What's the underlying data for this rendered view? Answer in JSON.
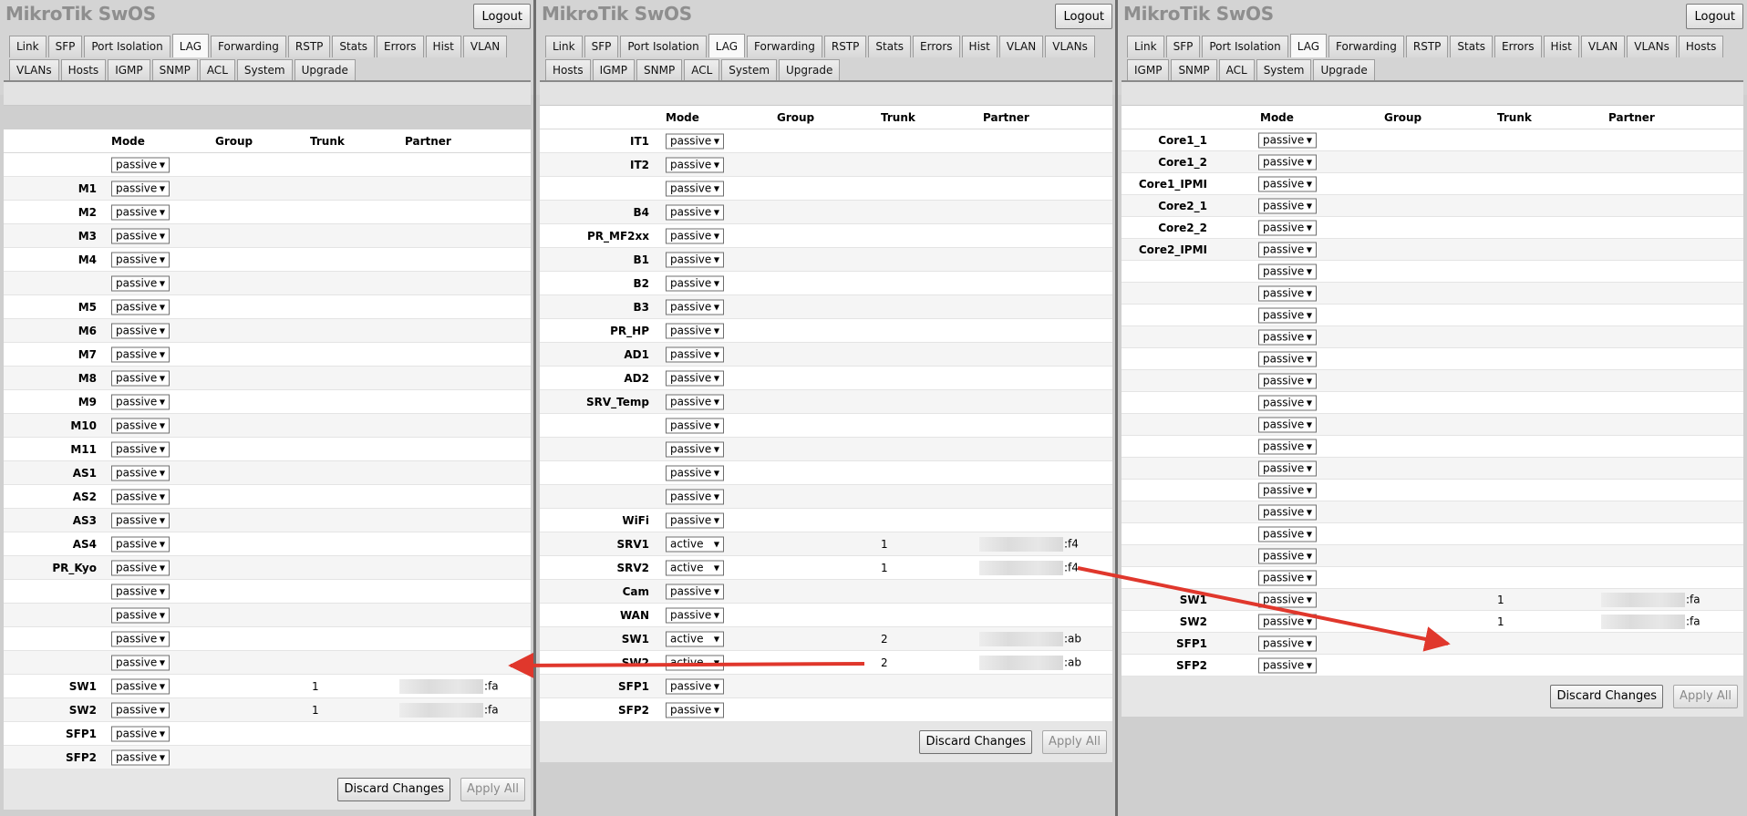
{
  "app": {
    "brand": "MikroTik SwOS",
    "logout_label": "Logout"
  },
  "colors": {
    "arrow": "#e0372c",
    "panel_bg": "#cfcfcf"
  },
  "headers": {
    "mode": "Mode",
    "group": "Group",
    "trunk": "Trunk",
    "partner": "Partner"
  },
  "buttons": {
    "discard": "Discard Changes",
    "apply": "Apply All"
  },
  "panels": [
    {
      "tabs_row1": [
        "Link",
        "SFP",
        "Port Isolation",
        "LAG",
        "Forwarding",
        "RSTP",
        "Stats",
        "Errors",
        "Hist",
        "VLAN"
      ],
      "tabs_row2": [
        "VLANs",
        "Hosts",
        "IGMP",
        "SNMP",
        "ACL",
        "System",
        "Upgrade"
      ],
      "active_tab": "LAG",
      "rows": [
        {
          "port": "",
          "mode": "passive",
          "trunk": "",
          "partner": ""
        },
        {
          "port": "M1",
          "mode": "passive",
          "trunk": "",
          "partner": ""
        },
        {
          "port": "M2",
          "mode": "passive",
          "trunk": "",
          "partner": ""
        },
        {
          "port": "M3",
          "mode": "passive",
          "trunk": "",
          "partner": ""
        },
        {
          "port": "M4",
          "mode": "passive",
          "trunk": "",
          "partner": ""
        },
        {
          "port": "",
          "mode": "passive",
          "trunk": "",
          "partner": ""
        },
        {
          "port": "M5",
          "mode": "passive",
          "trunk": "",
          "partner": ""
        },
        {
          "port": "M6",
          "mode": "passive",
          "trunk": "",
          "partner": ""
        },
        {
          "port": "M7",
          "mode": "passive",
          "trunk": "",
          "partner": ""
        },
        {
          "port": "M8",
          "mode": "passive",
          "trunk": "",
          "partner": ""
        },
        {
          "port": "M9",
          "mode": "passive",
          "trunk": "",
          "partner": ""
        },
        {
          "port": "M10",
          "mode": "passive",
          "trunk": "",
          "partner": ""
        },
        {
          "port": "M11",
          "mode": "passive",
          "trunk": "",
          "partner": ""
        },
        {
          "port": "AS1",
          "mode": "passive",
          "trunk": "",
          "partner": ""
        },
        {
          "port": "AS2",
          "mode": "passive",
          "trunk": "",
          "partner": ""
        },
        {
          "port": "AS3",
          "mode": "passive",
          "trunk": "",
          "partner": ""
        },
        {
          "port": "AS4",
          "mode": "passive",
          "trunk": "",
          "partner": ""
        },
        {
          "port": "PR_Kyo",
          "mode": "passive",
          "trunk": "",
          "partner": ""
        },
        {
          "port": "",
          "mode": "passive",
          "trunk": "",
          "partner": ""
        },
        {
          "port": "",
          "mode": "passive",
          "trunk": "",
          "partner": ""
        },
        {
          "port": "",
          "mode": "passive",
          "trunk": "",
          "partner": ""
        },
        {
          "port": "",
          "mode": "passive",
          "trunk": "",
          "partner": ""
        },
        {
          "port": "SW1",
          "mode": "passive",
          "trunk": "1",
          "partner": ":fa"
        },
        {
          "port": "SW2",
          "mode": "passive",
          "trunk": "1",
          "partner": ":fa"
        },
        {
          "port": "SFP1",
          "mode": "passive",
          "trunk": "",
          "partner": ""
        },
        {
          "port": "SFP2",
          "mode": "passive",
          "trunk": "",
          "partner": ""
        }
      ]
    },
    {
      "tabs_row1": [
        "Link",
        "SFP",
        "Port Isolation",
        "LAG",
        "Forwarding",
        "RSTP",
        "Stats",
        "Errors",
        "Hist",
        "VLAN",
        "VLANs"
      ],
      "tabs_row2": [
        "Hosts",
        "IGMP",
        "SNMP",
        "ACL",
        "System",
        "Upgrade"
      ],
      "active_tab": "LAG",
      "rows": [
        {
          "port": "IT1",
          "mode": "passive",
          "trunk": "",
          "partner": ""
        },
        {
          "port": "IT2",
          "mode": "passive",
          "trunk": "",
          "partner": ""
        },
        {
          "port": "",
          "mode": "passive",
          "trunk": "",
          "partner": ""
        },
        {
          "port": "B4",
          "mode": "passive",
          "trunk": "",
          "partner": ""
        },
        {
          "port": "PR_MF2xx",
          "mode": "passive",
          "trunk": "",
          "partner": ""
        },
        {
          "port": "B1",
          "mode": "passive",
          "trunk": "",
          "partner": ""
        },
        {
          "port": "B2",
          "mode": "passive",
          "trunk": "",
          "partner": ""
        },
        {
          "port": "B3",
          "mode": "passive",
          "trunk": "",
          "partner": ""
        },
        {
          "port": "PR_HP",
          "mode": "passive",
          "trunk": "",
          "partner": ""
        },
        {
          "port": "AD1",
          "mode": "passive",
          "trunk": "",
          "partner": ""
        },
        {
          "port": "AD2",
          "mode": "passive",
          "trunk": "",
          "partner": ""
        },
        {
          "port": "SRV_Temp",
          "mode": "passive",
          "trunk": "",
          "partner": ""
        },
        {
          "port": "",
          "mode": "passive",
          "trunk": "",
          "partner": ""
        },
        {
          "port": "",
          "mode": "passive",
          "trunk": "",
          "partner": ""
        },
        {
          "port": "",
          "mode": "passive",
          "trunk": "",
          "partner": ""
        },
        {
          "port": "",
          "mode": "passive",
          "trunk": "",
          "partner": ""
        },
        {
          "port": "WiFi",
          "mode": "passive",
          "trunk": "",
          "partner": ""
        },
        {
          "port": "SRV1",
          "mode": "active",
          "trunk": "1",
          "partner": ":f4"
        },
        {
          "port": "SRV2",
          "mode": "active",
          "trunk": "1",
          "partner": ":f4"
        },
        {
          "port": "Cam",
          "mode": "passive",
          "trunk": "",
          "partner": ""
        },
        {
          "port": "WAN",
          "mode": "passive",
          "trunk": "",
          "partner": ""
        },
        {
          "port": "SW1",
          "mode": "active",
          "trunk": "2",
          "partner": ":ab"
        },
        {
          "port": "SW2",
          "mode": "active",
          "trunk": "2",
          "partner": ":ab"
        },
        {
          "port": "SFP1",
          "mode": "passive",
          "trunk": "",
          "partner": ""
        },
        {
          "port": "SFP2",
          "mode": "passive",
          "trunk": "",
          "partner": ""
        }
      ]
    },
    {
      "tabs_row1": [
        "Link",
        "SFP",
        "Port Isolation",
        "LAG",
        "Forwarding",
        "RSTP",
        "Stats",
        "Errors",
        "Hist",
        "VLAN",
        "VLANs",
        "Hosts"
      ],
      "tabs_row2": [
        "IGMP",
        "SNMP",
        "ACL",
        "System",
        "Upgrade"
      ],
      "active_tab": "LAG",
      "rows": [
        {
          "port": "Core1_1",
          "mode": "passive",
          "trunk": "",
          "partner": ""
        },
        {
          "port": "Core1_2",
          "mode": "passive",
          "trunk": "",
          "partner": ""
        },
        {
          "port": "Core1_IPMI",
          "mode": "passive",
          "trunk": "",
          "partner": ""
        },
        {
          "port": "Core2_1",
          "mode": "passive",
          "trunk": "",
          "partner": ""
        },
        {
          "port": "Core2_2",
          "mode": "passive",
          "trunk": "",
          "partner": ""
        },
        {
          "port": "Core2_IPMI",
          "mode": "passive",
          "trunk": "",
          "partner": ""
        },
        {
          "port": "",
          "mode": "passive",
          "trunk": "",
          "partner": ""
        },
        {
          "port": "",
          "mode": "passive",
          "trunk": "",
          "partner": ""
        },
        {
          "port": "",
          "mode": "passive",
          "trunk": "",
          "partner": ""
        },
        {
          "port": "",
          "mode": "passive",
          "trunk": "",
          "partner": ""
        },
        {
          "port": "",
          "mode": "passive",
          "trunk": "",
          "partner": ""
        },
        {
          "port": "",
          "mode": "passive",
          "trunk": "",
          "partner": ""
        },
        {
          "port": "",
          "mode": "passive",
          "trunk": "",
          "partner": ""
        },
        {
          "port": "",
          "mode": "passive",
          "trunk": "",
          "partner": ""
        },
        {
          "port": "",
          "mode": "passive",
          "trunk": "",
          "partner": ""
        },
        {
          "port": "",
          "mode": "passive",
          "trunk": "",
          "partner": ""
        },
        {
          "port": "",
          "mode": "passive",
          "trunk": "",
          "partner": ""
        },
        {
          "port": "",
          "mode": "passive",
          "trunk": "",
          "partner": ""
        },
        {
          "port": "",
          "mode": "passive",
          "trunk": "",
          "partner": ""
        },
        {
          "port": "",
          "mode": "passive",
          "trunk": "",
          "partner": ""
        },
        {
          "port": "",
          "mode": "passive",
          "trunk": "",
          "partner": ""
        },
        {
          "port": "SW1",
          "mode": "passive",
          "trunk": "1",
          "partner": ":fa"
        },
        {
          "port": "SW2",
          "mode": "passive",
          "trunk": "1",
          "partner": ":fa"
        },
        {
          "port": "SFP1",
          "mode": "passive",
          "trunk": "",
          "partner": ""
        },
        {
          "port": "SFP2",
          "mode": "passive",
          "trunk": "",
          "partner": ""
        }
      ]
    }
  ]
}
